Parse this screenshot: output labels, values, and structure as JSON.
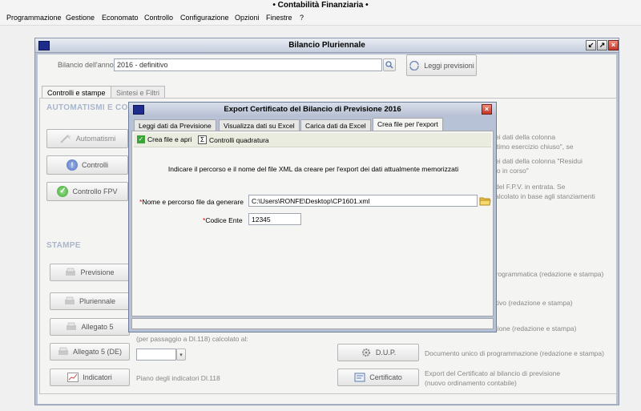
{
  "app": {
    "title": "• Contabilità Finanziaria •"
  },
  "menu": {
    "items": [
      "Programmazione",
      "Gestione",
      "Economato",
      "Controllo",
      "Configurazione",
      "Opzioni",
      "Finestre",
      "?"
    ]
  },
  "window": {
    "title": "Bilancio Pluriennale",
    "controls": {
      "minimize": "↙",
      "maximize": "↗",
      "close": "×"
    }
  },
  "header": {
    "year_label": "Bilancio dell'anno:",
    "year_value": "2016 - definitivo",
    "read_button": "Leggi previsioni"
  },
  "tabs": [
    "Controlli e stampe",
    "Sintesi e Filtri"
  ],
  "automatismi": {
    "title": "AUTOMATISMI E CON",
    "buttons": {
      "automatismi": "Automatismi",
      "controlli": "Controlli",
      "controllo_fpv": "Controllo FPV"
    },
    "desc": {
      "line1": "ei dati della colonna",
      "line2": "ltimo esercizio chiuso\", se",
      "line3": "ei dati della colonna \"Residui",
      "line4": "io in corso\"",
      "line5": "del F.P.V. in entrata. Se",
      "line6": "alcolato in base agli stanziamenti"
    }
  },
  "stampe": {
    "title": "STAMPE",
    "buttons": {
      "previsione": "Previsione",
      "pluriennale": "Pluriennale",
      "allegato5": "Allegato 5",
      "allegato5de": "Allegato 5 (DE)",
      "indicatori": "Indicatori",
      "dup": "D.U.P.",
      "certificato": "Certificato"
    },
    "desc": {
      "previsione": "programmatica (redazione e stampa)",
      "pluriennale": "ntivo (redazione e stampa)",
      "allegato5": "stione (redazione e stampa)",
      "passaggio": "(per passaggio a Dl.118) calcolato al:",
      "indicatori": "Piano degli indicatori Dl.118",
      "dup": "Documento unico di programmazione (redazione e stampa)",
      "certificato_1": "Export del Certificato al bilancio di previsione",
      "certificato_2": "(nuovo ordinamento contabile)"
    },
    "date_value": ""
  },
  "dialog": {
    "title": "Export Certificato del Bilancio di Previsione 2016",
    "close": "×",
    "tabs": [
      "Leggi dati da Previsione",
      "Visualizza dati su Excel",
      "Carica dati da Excel",
      "Crea file per l'export"
    ],
    "toolbar": {
      "create_open": "Crea file e apri",
      "check": "Controlli quadratura"
    },
    "instruction": "Indicare il percorso e il nome del file XML da creare per l'export dei dati attualmente memorizzati",
    "fields": {
      "path_label": "Nome e percorso file da generare",
      "path_value": "C:\\Users\\RONFE\\Desktop\\CP1601.xml",
      "ente_label": "Codice Ente",
      "ente_value": "12345",
      "required_marker": "*"
    }
  },
  "colors": {
    "window_frame": "#b9c2d2",
    "dialog_frame": "#b8c2d6",
    "section_title": "#a9b6cb",
    "required": "#dd0000"
  }
}
